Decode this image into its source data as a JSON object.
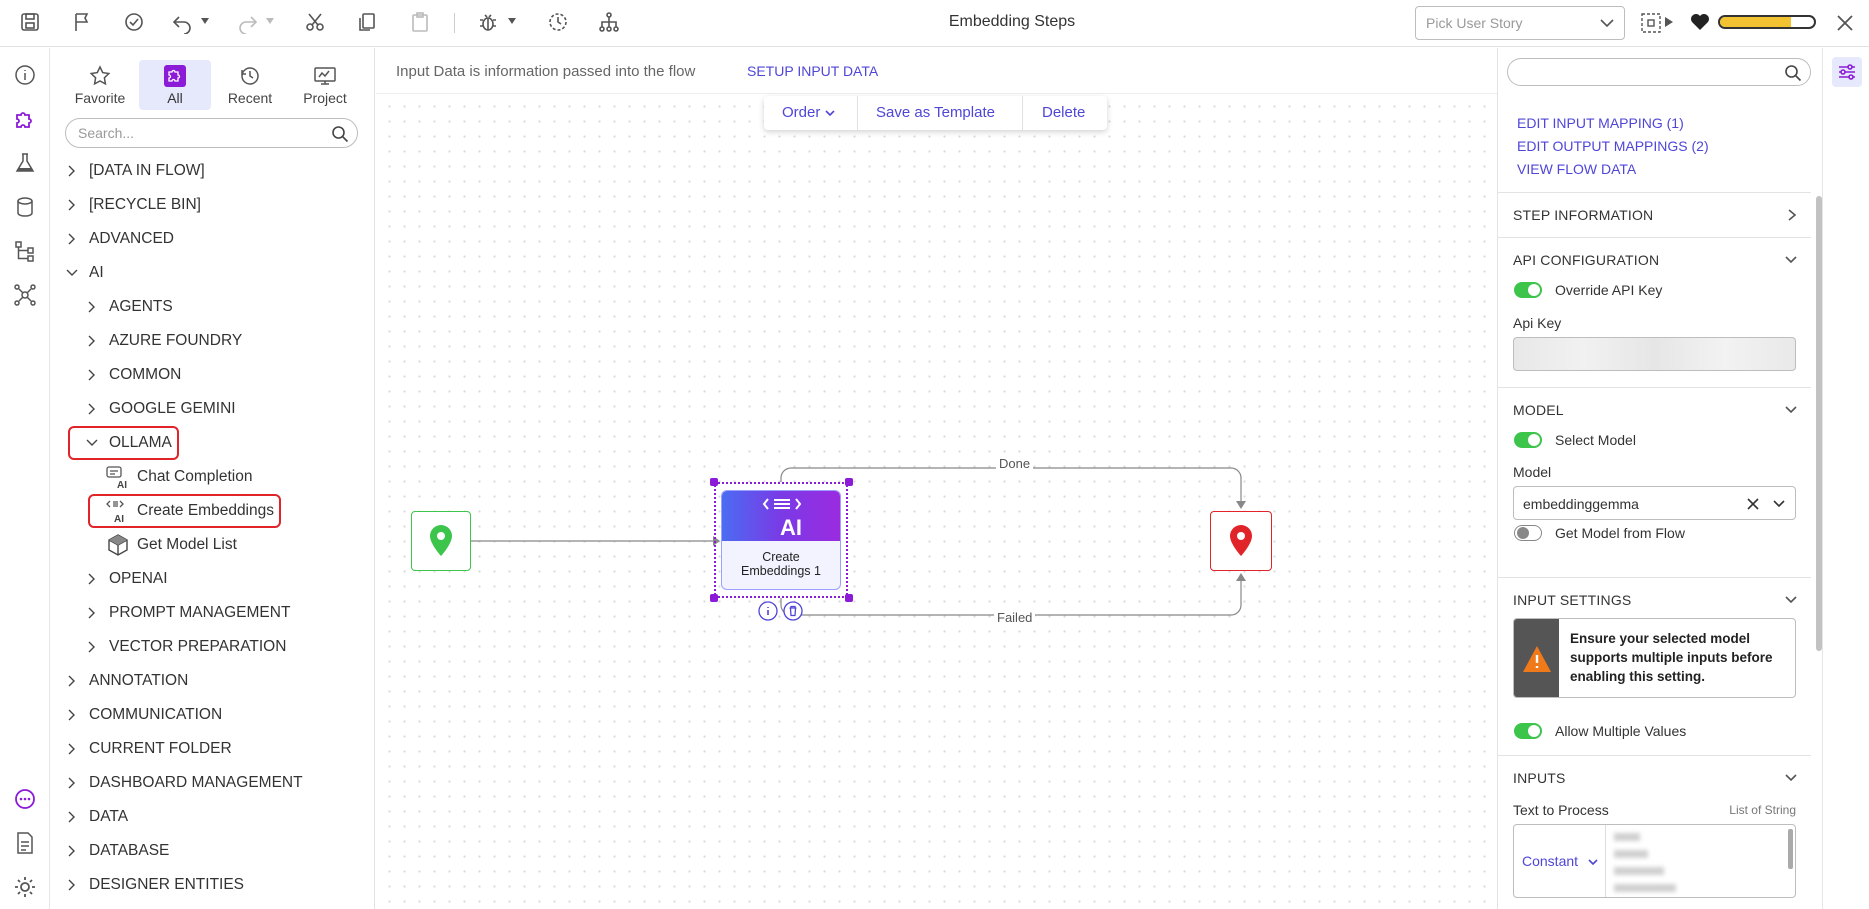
{
  "window": {
    "title": "Embedding Steps"
  },
  "topbar": {
    "story_placeholder": "Pick User Story",
    "progress": 0.75,
    "colors": {
      "progress_fill": "#f2c230",
      "heart": "#222"
    }
  },
  "toolbox": {
    "tabs": [
      {
        "label": "Favorite",
        "icon": "star-icon"
      },
      {
        "label": "All",
        "icon": "puzzle-icon",
        "active": true
      },
      {
        "label": "Recent",
        "icon": "history-icon"
      },
      {
        "label": "Project",
        "icon": "project-icon"
      }
    ],
    "search_placeholder": "Search...",
    "tree": [
      {
        "label": "[DATA IN FLOW]",
        "level": 0,
        "expanded": false
      },
      {
        "label": "[RECYCLE BIN]",
        "level": 0,
        "expanded": false
      },
      {
        "label": "ADVANCED",
        "level": 0,
        "expanded": false
      },
      {
        "label": "AI",
        "level": 0,
        "expanded": true
      },
      {
        "label": "AGENTS",
        "level": 1,
        "expanded": false
      },
      {
        "label": "AZURE FOUNDRY",
        "level": 1,
        "expanded": false
      },
      {
        "label": "COMMON",
        "level": 1,
        "expanded": false
      },
      {
        "label": "GOOGLE GEMINI",
        "level": 1,
        "expanded": false
      },
      {
        "label": "OLLAMA",
        "level": 1,
        "expanded": true,
        "highlighted": true
      },
      {
        "label": "Chat Completion",
        "level": 2,
        "leaf": true,
        "icon": "ai-chat-icon"
      },
      {
        "label": "Create Embeddings",
        "level": 2,
        "leaf": true,
        "icon": "ai-embed-icon",
        "highlighted": true
      },
      {
        "label": "Get Model List",
        "level": 2,
        "leaf": true,
        "icon": "cube-icon"
      },
      {
        "label": "OPENAI",
        "level": 1,
        "expanded": false
      },
      {
        "label": "PROMPT MANAGEMENT",
        "level": 1,
        "expanded": false
      },
      {
        "label": "VECTOR PREPARATION",
        "level": 1,
        "expanded": false
      },
      {
        "label": "ANNOTATION",
        "level": 0,
        "expanded": false
      },
      {
        "label": "COMMUNICATION",
        "level": 0,
        "expanded": false
      },
      {
        "label": "CURRENT FOLDER",
        "level": 0,
        "expanded": false
      },
      {
        "label": "DASHBOARD MANAGEMENT",
        "level": 0,
        "expanded": false
      },
      {
        "label": "DATA",
        "level": 0,
        "expanded": false
      },
      {
        "label": "DATABASE",
        "level": 0,
        "expanded": false
      },
      {
        "label": "DESIGNER ENTITIES",
        "level": 0,
        "expanded": false
      }
    ]
  },
  "canvas": {
    "input_info": "Input Data is information passed into the flow",
    "setup_link": "SETUP INPUT DATA",
    "actions": {
      "order": "Order",
      "save_template": "Save as Template",
      "delete": "Delete"
    },
    "step": {
      "label_line1": "Create",
      "label_line2": "Embeddings 1",
      "badge": "AI"
    },
    "edges": {
      "done": "Done",
      "failed": "Failed"
    },
    "colors": {
      "start": "#3cc54a",
      "end": "#e0242a",
      "selection": "#8b1bd6"
    }
  },
  "props": {
    "links": [
      "EDIT INPUT MAPPING (1)",
      "EDIT OUTPUT MAPPINGS (2)",
      "VIEW FLOW DATA"
    ],
    "step_info": "STEP INFORMATION",
    "api": {
      "title": "API CONFIGURATION",
      "override_label": "Override API Key",
      "override_on": true,
      "key_label": "Api Key"
    },
    "model": {
      "title": "MODEL",
      "select_label": "Select Model",
      "select_on": true,
      "model_label": "Model",
      "model_value": "embeddinggemma",
      "from_flow_label": "Get Model from Flow",
      "from_flow_on": false
    },
    "input_settings": {
      "title": "INPUT SETTINGS",
      "warning": "Ensure your selected model supports multiple inputs before enabling this setting.",
      "allow_label": "Allow Multiple Values",
      "allow_on": true
    },
    "inputs": {
      "title": "INPUTS",
      "text_label": "Text to Process",
      "type_label": "List of String",
      "mode": "Constant"
    }
  }
}
